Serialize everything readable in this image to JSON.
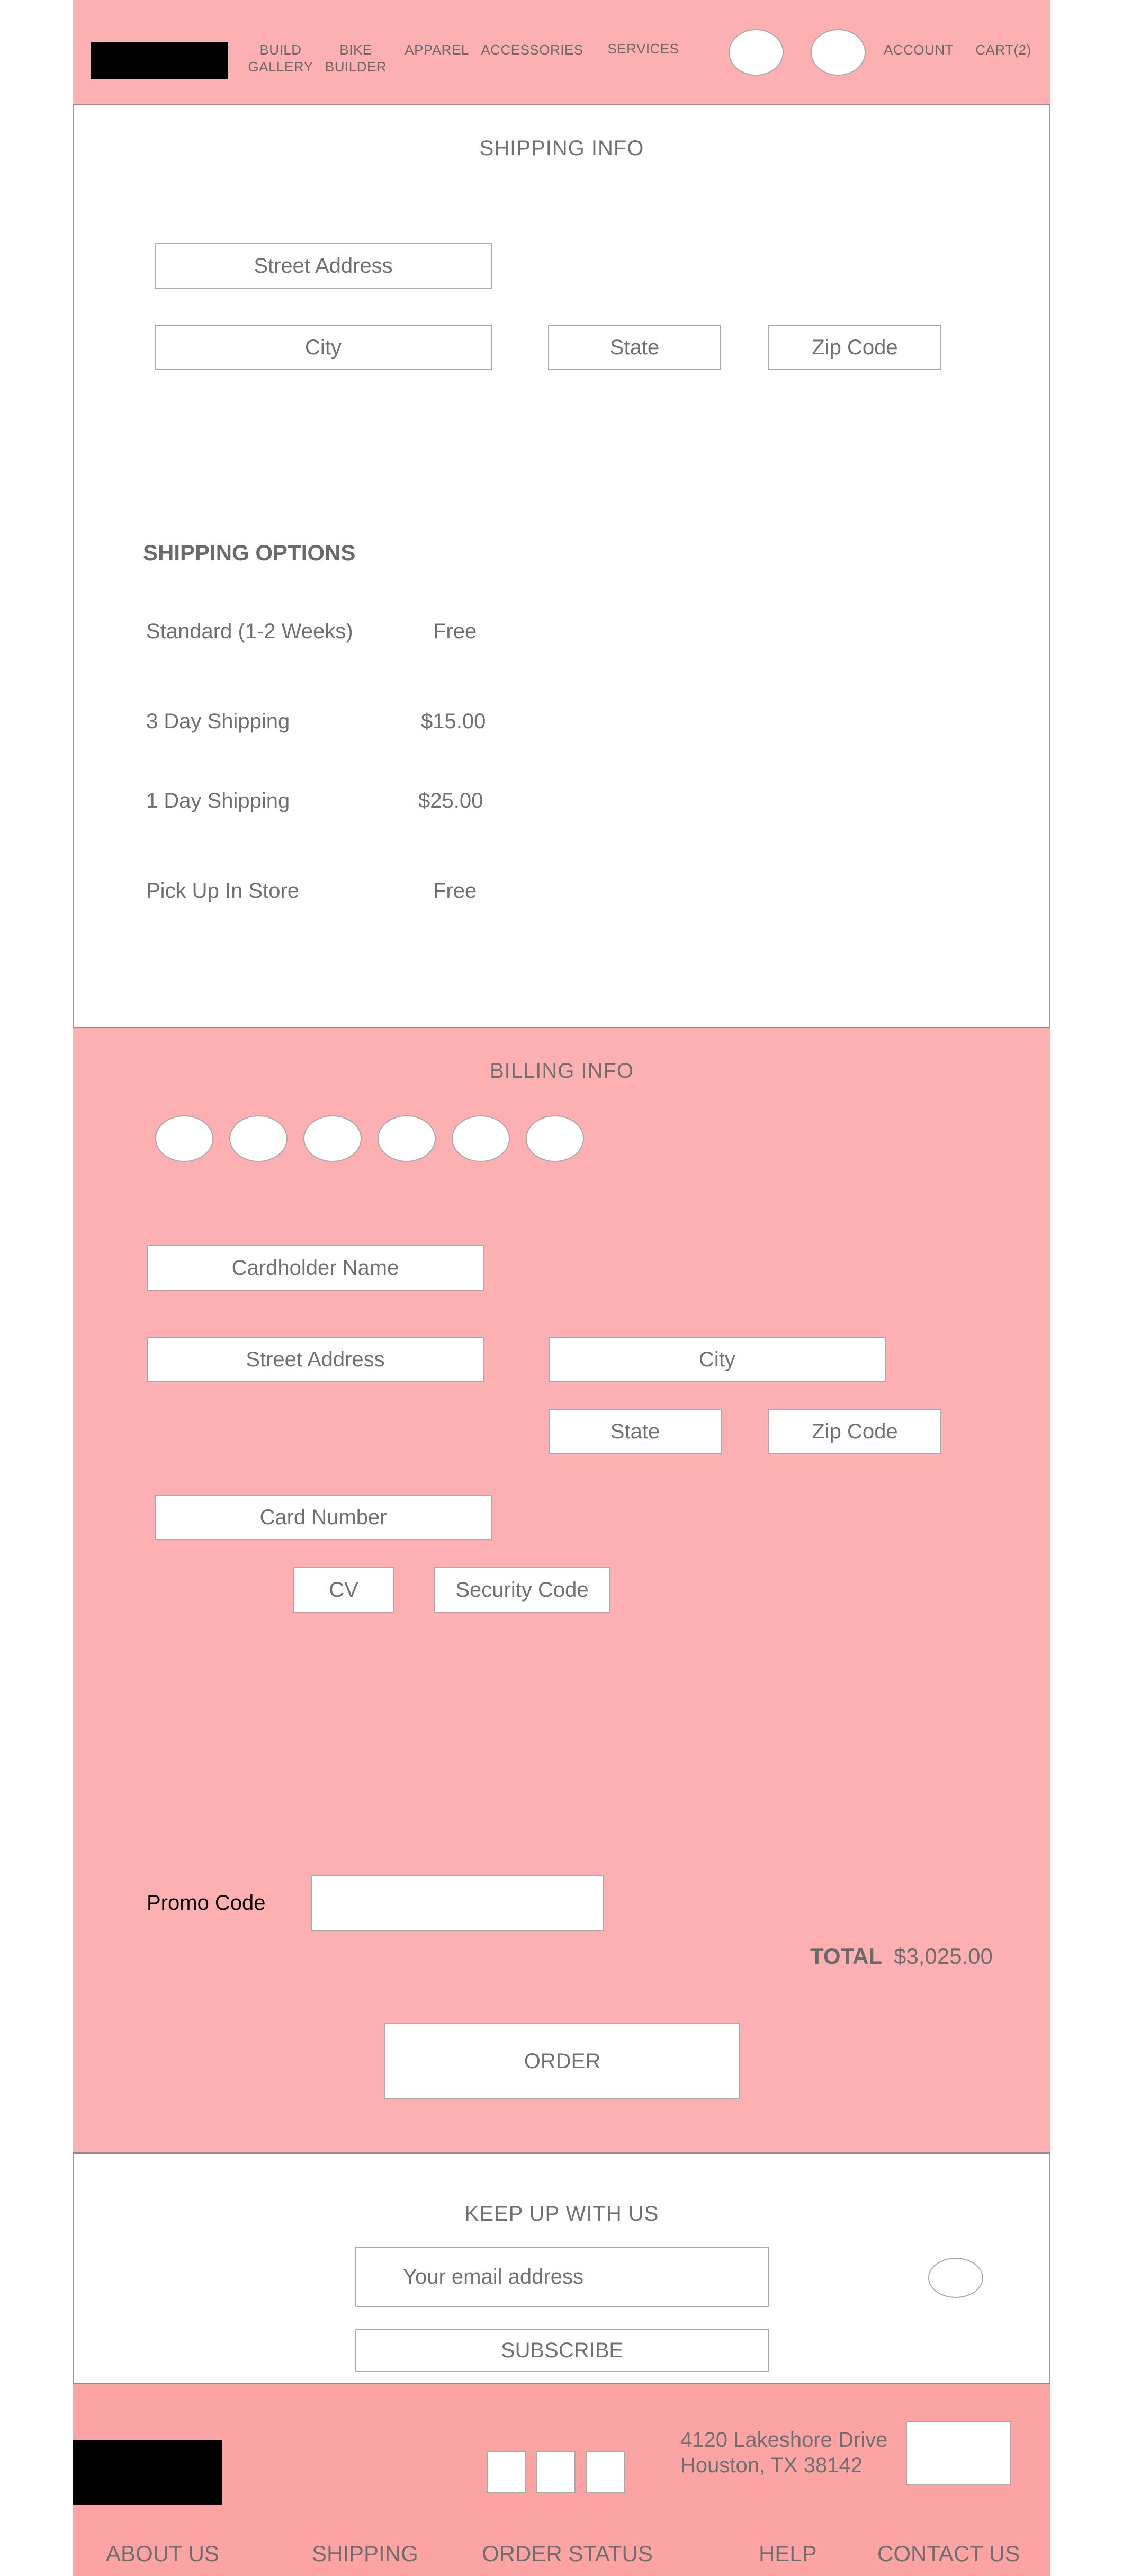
{
  "header": {
    "nav": [
      {
        "label": "BUILD\nGALLERY"
      },
      {
        "label": "BIKE\nBUILDER"
      },
      {
        "label": "APPAREL"
      },
      {
        "label": "ACCESSORIES"
      },
      {
        "label": "SERVICES"
      }
    ],
    "account_label": "ACCOUNT",
    "cart_label": "CART(2)"
  },
  "shipping_info": {
    "title": "SHIPPING INFO",
    "street_address": "Street Address",
    "city": "City",
    "state": "State",
    "zip_code": "Zip Code"
  },
  "shipping_options": {
    "title": "SHIPPING OPTIONS",
    "options": [
      {
        "name": "Standard (1-2 Weeks)",
        "price": "Free"
      },
      {
        "name": "3 Day Shipping",
        "price": "$15.00"
      },
      {
        "name": "1 Day Shipping",
        "price": "$25.00"
      },
      {
        "name": "Pick Up In Store",
        "price": "Free"
      }
    ]
  },
  "billing_info": {
    "title": "BILLING INFO",
    "cardholder_name": "Cardholder Name",
    "street_address": "Street Address",
    "city": "City",
    "state": "State",
    "zip_code": "Zip Code",
    "card_number": "Card Number",
    "cv": "CV",
    "security_code": "Security Code",
    "promo_label": "Promo Code",
    "promo_value": "",
    "total_label": "TOTAL",
    "total_value": "$3,025.00",
    "order_button": "ORDER"
  },
  "newsletter": {
    "title": "KEEP UP WITH US",
    "email_placeholder": "Your email address",
    "subscribe_button": "SUBSCRIBE"
  },
  "footer": {
    "address_line1": "4120 Lakeshore Drive",
    "address_line2": "Houston, TX 38142",
    "links": [
      "ABOUT US",
      "SHIPPING",
      "ORDER STATUS",
      "HELP",
      "CONTACT US"
    ]
  },
  "colors": {
    "pink": "#fdb0b1",
    "footer_pink": "#fca4a4",
    "logo": "#000000"
  }
}
